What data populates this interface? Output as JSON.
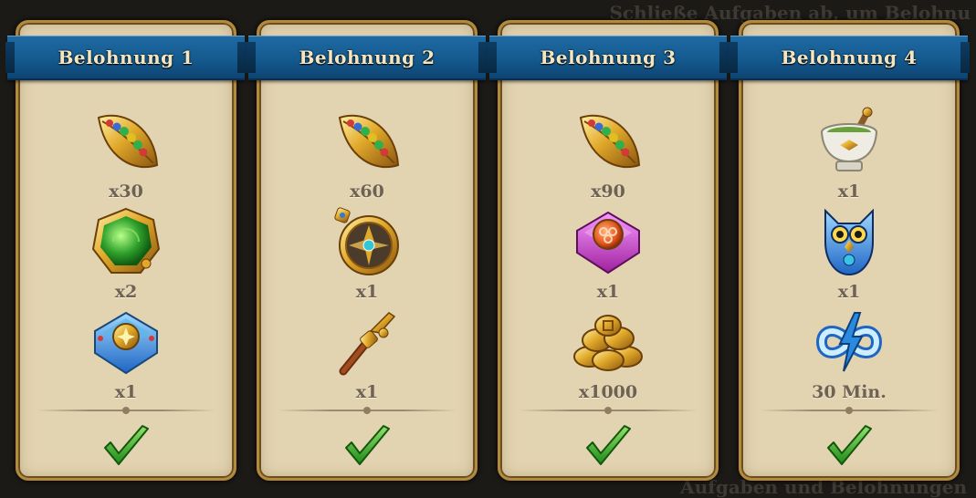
{
  "background": {
    "top_text": "Schließe Aufgaben ab, um Belohnu",
    "bottom_text": "Aufgaben und Belohnungen"
  },
  "colors": {
    "ribbon": "#165c92",
    "panel": "#e2d3b1",
    "frame": "#b38a3a",
    "check": "#3aa82a"
  },
  "panels": [
    {
      "title": "Belohnung 1",
      "completed": true,
      "rewards": [
        {
          "icon": "gem-leaf-icon",
          "qty": "x30"
        },
        {
          "icon": "green-emblem-icon",
          "qty": "x2"
        },
        {
          "icon": "blue-sun-box-icon",
          "qty": "x1"
        }
      ]
    },
    {
      "title": "Belohnung 2",
      "completed": true,
      "rewards": [
        {
          "icon": "gem-leaf-icon",
          "qty": "x60"
        },
        {
          "icon": "compass-amulet-icon",
          "qty": "x1"
        },
        {
          "icon": "pointing-wand-icon",
          "qty": "x1"
        }
      ]
    },
    {
      "title": "Belohnung 3",
      "completed": true,
      "rewards": [
        {
          "icon": "gem-leaf-icon",
          "qty": "x90"
        },
        {
          "icon": "pink-clover-box-icon",
          "qty": "x1"
        },
        {
          "icon": "gold-coins-icon",
          "qty": "x1000"
        }
      ]
    },
    {
      "title": "Belohnung 4",
      "completed": true,
      "rewards": [
        {
          "icon": "mortar-pestle-icon",
          "qty": "x1"
        },
        {
          "icon": "blue-owl-icon",
          "qty": "x1"
        },
        {
          "icon": "infinite-energy-icon",
          "qty": "30 Min."
        }
      ]
    }
  ]
}
